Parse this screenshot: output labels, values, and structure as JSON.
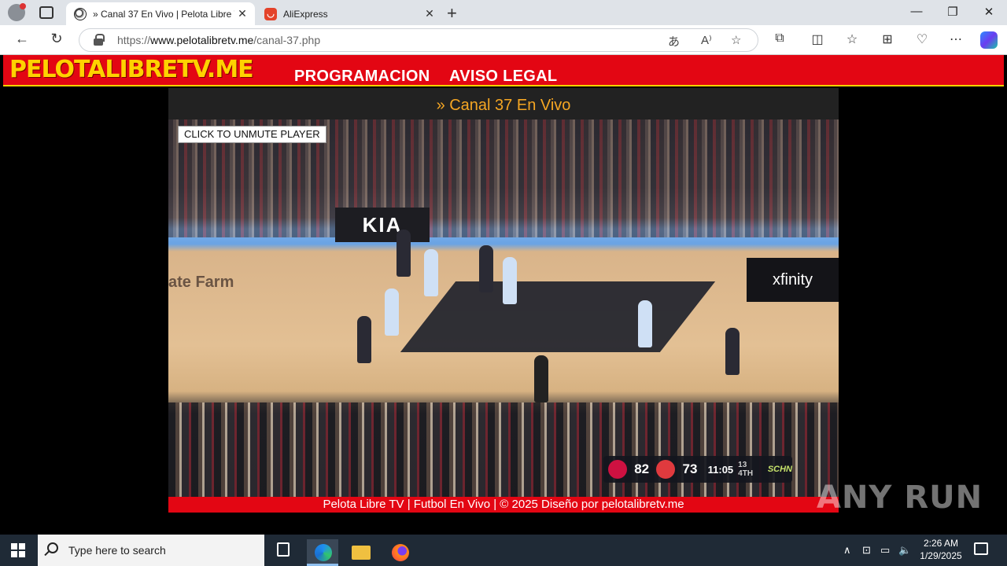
{
  "browser": {
    "tabs": [
      {
        "title": "» Canal 37 En Vivo | Pelota Libre TV",
        "active": true
      },
      {
        "title": "AliExpress",
        "active": false
      }
    ],
    "url_prefix": "https://",
    "url_domain": "www.pelotalibretv.me",
    "url_path": "/canal-37.php"
  },
  "site": {
    "logo": "PELOTALIBRETV.ME",
    "menu": [
      "PROGRAMACION",
      "AVISO LEGAL"
    ],
    "channel_title": "» Canal 37 En Vivo",
    "unmute_button": "CLICK TO UNMUTE PLAYER",
    "footer": "Pelota Libre TV | Futbol En Vivo | © 2025 Diseño por pelotalibretv.me"
  },
  "video": {
    "arena_boards": [
      "KIA",
      "xfinity"
    ],
    "court_text": "ate Farm",
    "scoreboard": {
      "home_score": "82",
      "away_score": "73",
      "clock": "11:05",
      "period": "13 4TH",
      "network": "SCHN"
    }
  },
  "watermark": "ANY RUN",
  "taskbar": {
    "search_placeholder": "Type here to search",
    "time": "2:26 AM",
    "date": "1/29/2025"
  },
  "colors": {
    "brand_red": "#e30613",
    "logo_yellow": "#ffd200",
    "title_orange": "#f5a623"
  }
}
